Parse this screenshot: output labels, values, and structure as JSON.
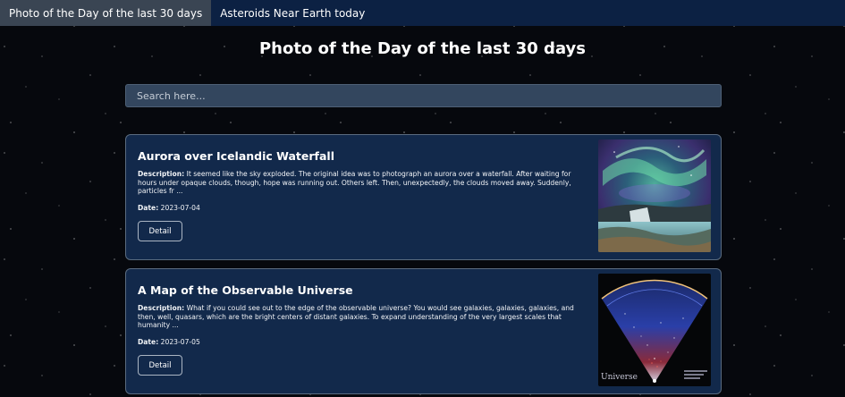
{
  "nav": {
    "items": [
      {
        "label": "Photo of the Day of the last 30 days",
        "active": true
      },
      {
        "label": "Asteroids Near Earth today",
        "active": false
      }
    ]
  },
  "page": {
    "title": "Photo of the Day of the last 30 days"
  },
  "search": {
    "placeholder": "Search here...",
    "value": ""
  },
  "labels": {
    "description": "Description:",
    "date": "Date:",
    "detail": "Detail"
  },
  "cards": [
    {
      "title": "Aurora over Icelandic Waterfall",
      "description": "It seemed like the sky exploded. The original idea was to photograph an aurora over a waterfall. After waiting for hours under opaque clouds, though, hope was running out. Others left. Then, unexpectedly, the clouds moved away. Suddenly, particles fr ...",
      "date": "2023-07-04",
      "image_icon": "aurora-photo"
    },
    {
      "title": "A Map of the Observable Universe",
      "description": "What if you could see out to the edge of the observable universe? You would see galaxies, galaxies, galaxies, and then, well, quasars, which are the bright centers of distant galaxies. To expand understanding of the very largest scales that humanity ...",
      "date": "2023-07-05",
      "image_icon": "universe-map-photo",
      "image_text": "Universe"
    }
  ],
  "colors": {
    "navbar": "#0c2143",
    "nav_active": "#3a4553",
    "card_bg": "#12294b",
    "search_bg": "#33465e"
  }
}
